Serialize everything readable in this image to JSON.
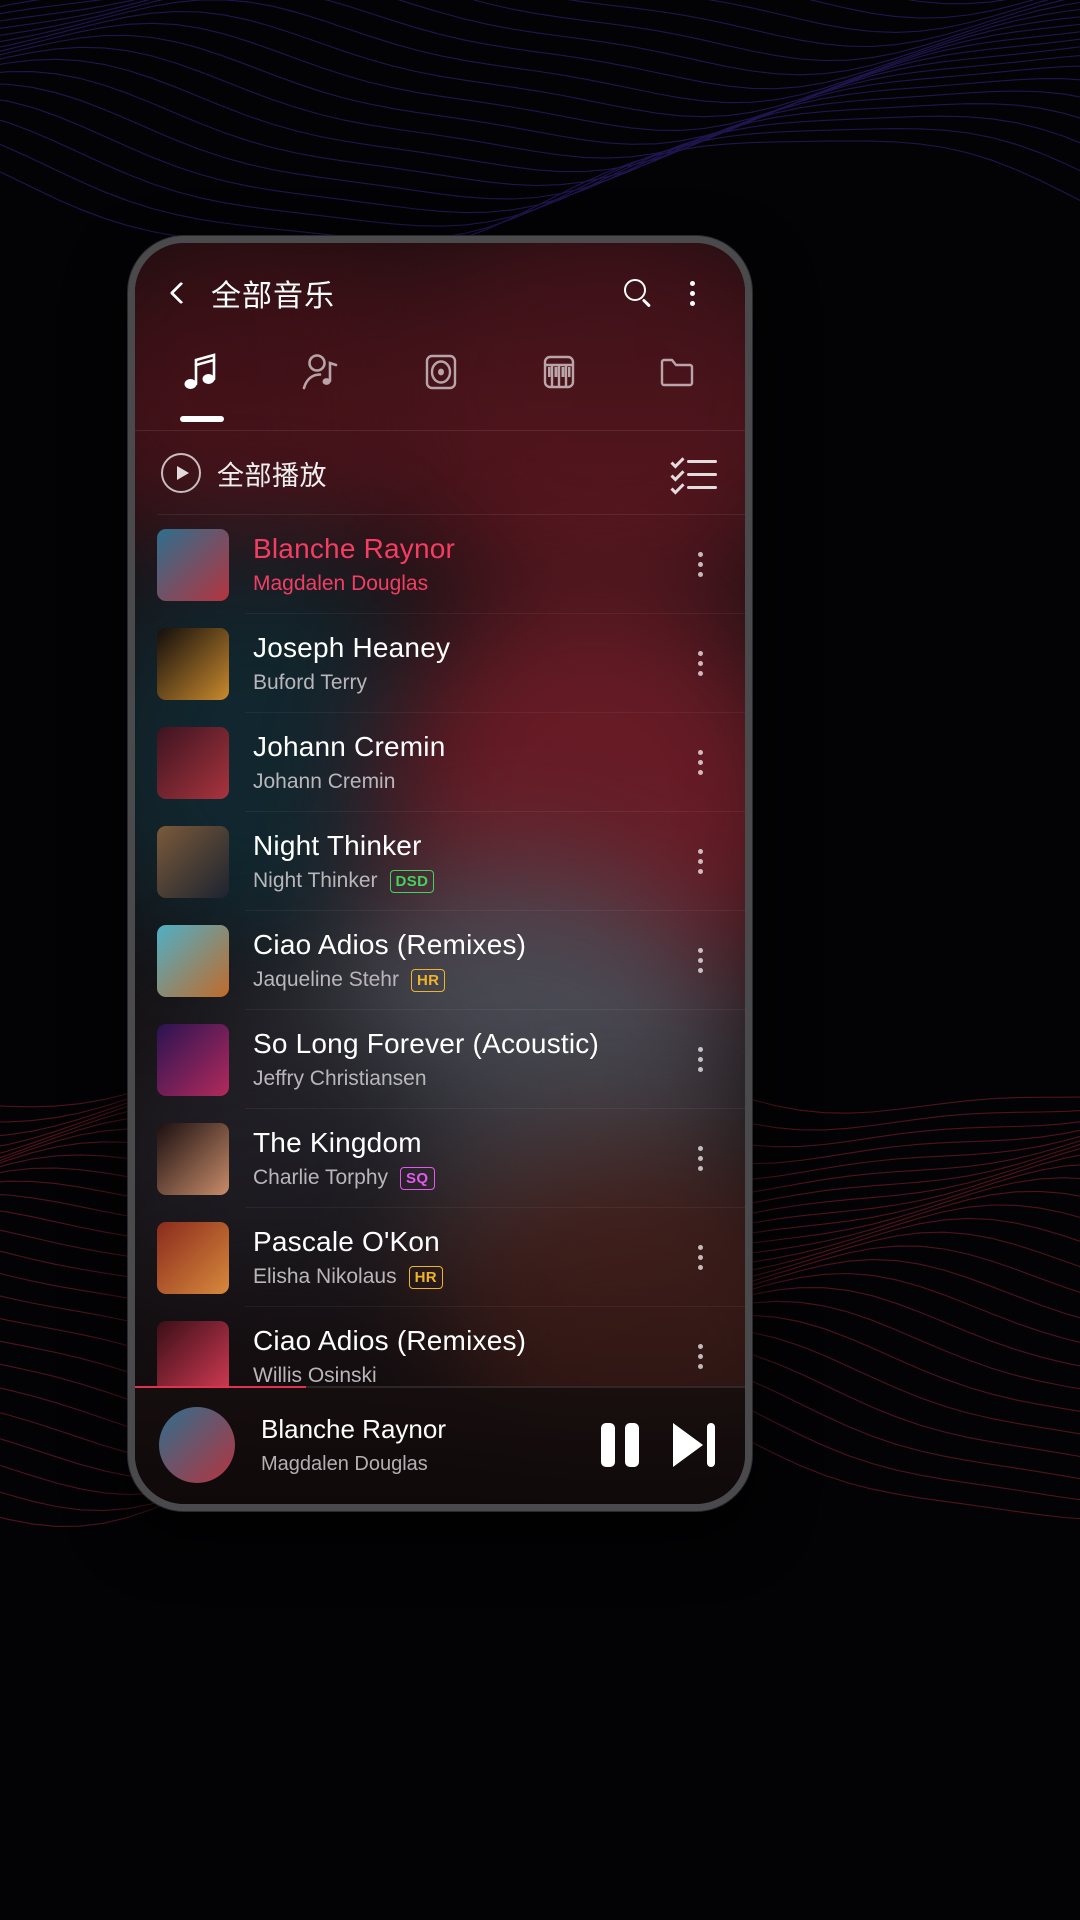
{
  "appbar": {
    "back_icon": "chevron-left-icon",
    "title": "全部音乐",
    "search_icon": "search-icon",
    "overflow_icon": "kebab-menu-icon"
  },
  "tabs": [
    {
      "id": "songs",
      "icon": "music-note-icon",
      "active": true
    },
    {
      "id": "artists",
      "icon": "artist-note-icon",
      "active": false
    },
    {
      "id": "albums",
      "icon": "album-disc-icon",
      "active": false
    },
    {
      "id": "genres",
      "icon": "piano-keys-icon",
      "active": false
    },
    {
      "id": "folders",
      "icon": "folder-icon",
      "active": false
    }
  ],
  "playall": {
    "icon": "play-circle-icon",
    "label": "全部播放",
    "multiselect_icon": "checklist-icon"
  },
  "tracks": [
    {
      "title": "Blanche Raynor",
      "artist": "Magdalen Douglas",
      "badge": "",
      "badge_color": "",
      "playing": true,
      "cover_from": "#2d6f8e",
      "cover_to": "#b5343f",
      "menu_icon": "kebab-menu-icon"
    },
    {
      "title": "Joseph Heaney",
      "artist": "Buford Terry",
      "badge": "",
      "badge_color": "",
      "playing": false,
      "cover_from": "#120d0c",
      "cover_to": "#c98a2e",
      "menu_icon": "kebab-menu-icon"
    },
    {
      "title": "Johann Cremin",
      "artist": "Johann Cremin",
      "badge": "",
      "badge_color": "",
      "playing": false,
      "cover_from": "#3c1420",
      "cover_to": "#a8343e",
      "menu_icon": "kebab-menu-icon"
    },
    {
      "title": "Night Thinker",
      "artist": "Night Thinker",
      "badge": "DSD",
      "badge_color": "#46d15e",
      "playing": false,
      "cover_from": "#7a5a3a",
      "cover_to": "#1d2330",
      "menu_icon": "kebab-menu-icon"
    },
    {
      "title": "Ciao Adios (Remixes)",
      "artist": "Jaqueline Stehr",
      "badge": "HR",
      "badge_color": "#f0b429",
      "playing": false,
      "cover_from": "#4fb0c6",
      "cover_to": "#c06a2a",
      "menu_icon": "kebab-menu-icon"
    },
    {
      "title": "So Long Forever (Acoustic)",
      "artist": "Jeffry Christiansen",
      "badge": "",
      "badge_color": "",
      "playing": false,
      "cover_from": "#2a1352",
      "cover_to": "#b32a5c",
      "menu_icon": "kebab-menu-icon"
    },
    {
      "title": "The Kingdom",
      "artist": "Charlie Torphy",
      "badge": "SQ",
      "badge_color": "#e457f0",
      "playing": false,
      "cover_from": "#1a0f10",
      "cover_to": "#c98c6a",
      "menu_icon": "kebab-menu-icon"
    },
    {
      "title": "Pascale O'Kon",
      "artist": "Elisha Nikolaus",
      "badge": "HR",
      "badge_color": "#f0b429",
      "playing": false,
      "cover_from": "#8a2b1d",
      "cover_to": "#d8893c",
      "menu_icon": "kebab-menu-icon"
    },
    {
      "title": "Ciao Adios (Remixes)",
      "artist": "Willis Osinski",
      "badge": "",
      "badge_color": "",
      "playing": false,
      "cover_from": "#3a0f18",
      "cover_to": "#d23a52",
      "menu_icon": "kebab-menu-icon"
    }
  ],
  "miniplayer": {
    "title": "Blanche Raynor",
    "artist": "Magdalen Douglas",
    "progress_percent": 28,
    "progress_color": "#e0324f",
    "pause_icon": "pause-icon",
    "next_icon": "next-track-icon",
    "cover_from": "#2d6f8e",
    "cover_to": "#b5343f"
  },
  "theme": {
    "accent": "#f43d62",
    "background": "#030305"
  }
}
